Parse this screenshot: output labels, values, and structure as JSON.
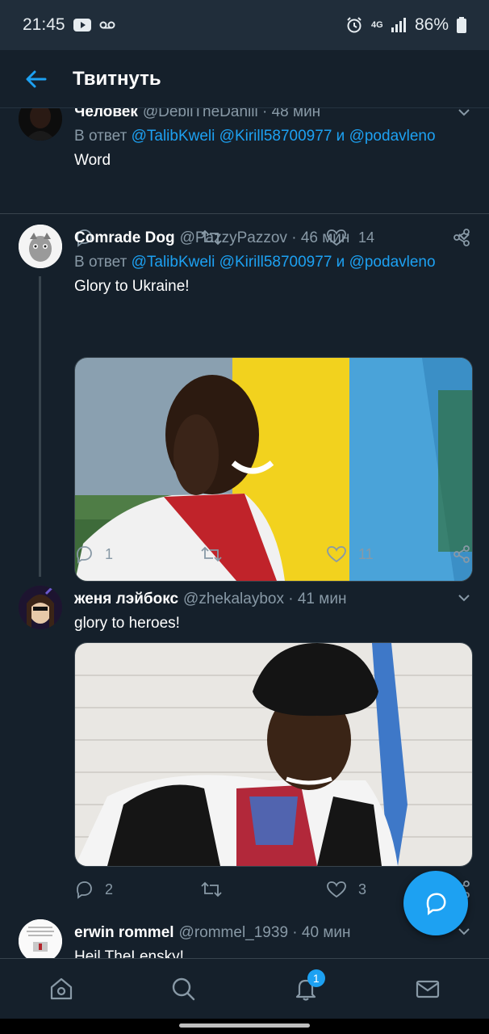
{
  "status_bar": {
    "time": "21:45",
    "network": "4G",
    "battery": "86%"
  },
  "header": {
    "title": "Твитнуть"
  },
  "tweets": [
    {
      "name": "Человек",
      "handle": "@DebilTheDanill",
      "time": "48 мин",
      "reply_prefix": "В ответ",
      "mentions": [
        "@TalibKweli",
        "@Kirill58700977"
      ],
      "joiner": "и",
      "last_mention": "@podavleno",
      "text": "Word",
      "replies": "",
      "likes": "14"
    },
    {
      "name": "Comrade Dog",
      "handle": "@PazzyPazzov",
      "time": "46 мин",
      "reply_prefix": "В ответ",
      "mentions": [
        "@TalibKweli",
        "@Kirill58700977"
      ],
      "joiner": "и",
      "last_mention": "@podavleno",
      "text": "Glory to Ukraine!",
      "replies": "1",
      "likes": "11"
    },
    {
      "name": "женя лэйбокс",
      "handle": "@zhekalaybox",
      "time": "41 мин",
      "text": "glory to heroes!",
      "replies": "2",
      "likes": "3"
    },
    {
      "name": "erwin rommel",
      "handle": "@rommel_1939",
      "time": "40 мин",
      "text": "Heil TheLensky!"
    }
  ],
  "nav": {
    "notification_count": "1"
  },
  "colors": {
    "background": "#15202b",
    "accent": "#1da1f2",
    "muted": "#8899a6"
  }
}
